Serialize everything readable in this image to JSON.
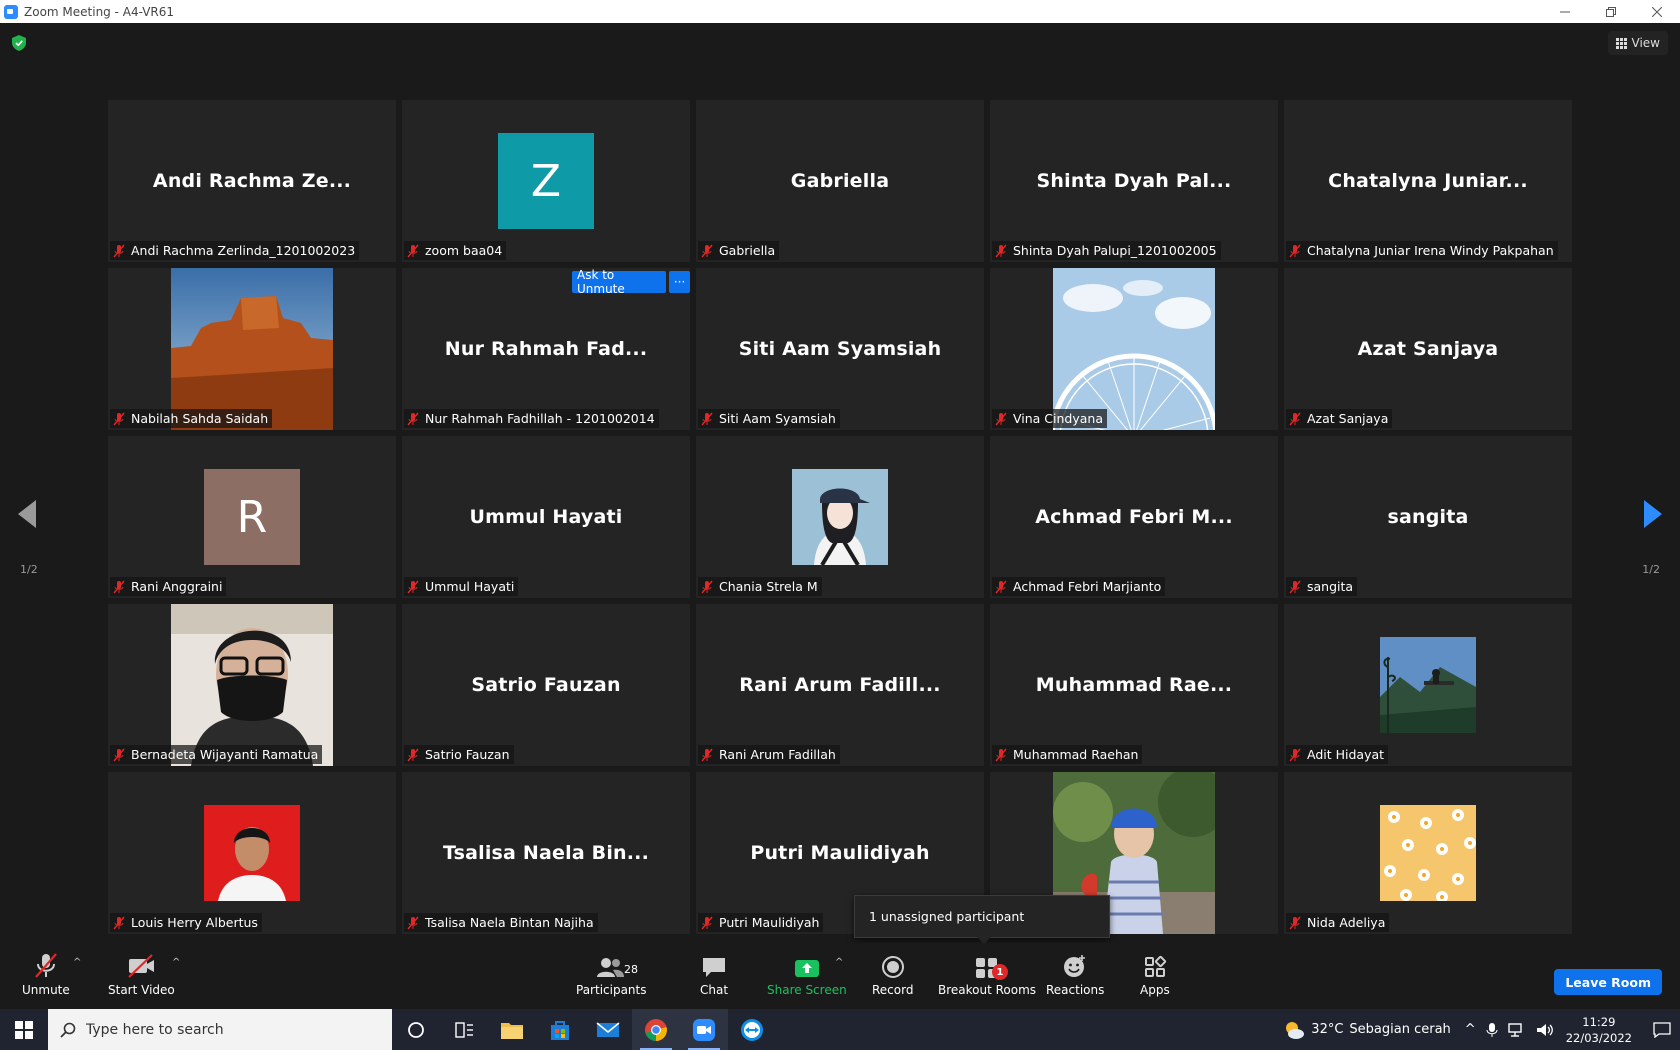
{
  "window": {
    "title": "Zoom Meeting - A4-VR61"
  },
  "header": {
    "view_label": "View"
  },
  "pagination": {
    "left": "1/2",
    "right": "1/2"
  },
  "tiles": [
    {
      "display_name": "Andi Rachma Ze...",
      "label": "Andi Rachma Zerlinda_1201002023",
      "kind": "name"
    },
    {
      "display_name": "Z",
      "label": "zoom baa04",
      "kind": "letter",
      "color": "#0e9aa7"
    },
    {
      "display_name": "Gabriella",
      "label": "Gabriella",
      "kind": "name"
    },
    {
      "display_name": "Shinta Dyah Pal...",
      "label": "Shinta Dyah Palupi_1201002005",
      "kind": "name"
    },
    {
      "display_name": "Chatalyna Juniar...",
      "label": "Chatalyna Juniar Irena Windy Pakpahan",
      "kind": "name"
    },
    {
      "display_name": "",
      "label": "Nabilah Sahda Saidah",
      "kind": "photo",
      "photo": "desert-butte"
    },
    {
      "display_name": "Nur Rahmah Fad...",
      "label": "Nur Rahmah Fadhillah - 1201002014",
      "kind": "name",
      "ask_unmute": "Ask to Unmute",
      "more": "···"
    },
    {
      "display_name": "Siti Aam Syamsiah",
      "label": "Siti Aam Syamsiah",
      "kind": "name"
    },
    {
      "display_name": "",
      "label": "Vina Cindyana",
      "kind": "photo",
      "photo": "ferris-wheel"
    },
    {
      "display_name": "Azat Sanjaya",
      "label": "Azat Sanjaya",
      "kind": "name"
    },
    {
      "display_name": "R",
      "label": "Rani Anggraini",
      "kind": "letter",
      "color": "#8c6e64"
    },
    {
      "display_name": "Ummul Hayati",
      "label": "Ummul Hayati",
      "kind": "name"
    },
    {
      "display_name": "",
      "label": "Chania Strela M",
      "kind": "photo-sq",
      "photo": "illustration-girl"
    },
    {
      "display_name": "Achmad Febri M...",
      "label": "Achmad Febri Marjianto",
      "kind": "name"
    },
    {
      "display_name": "sangita",
      "label": "sangita",
      "kind": "name"
    },
    {
      "display_name": "",
      "label": "Bernadeta Wijayanti Ramatua",
      "kind": "photo",
      "photo": "masked-person"
    },
    {
      "display_name": "Satrio Fauzan",
      "label": "Satrio Fauzan",
      "kind": "name"
    },
    {
      "display_name": "Rani Arum Fadill...",
      "label": "Rani Arum Fadillah",
      "kind": "name"
    },
    {
      "display_name": "Muhammad Rae...",
      "label": "Muhammad Raehan",
      "kind": "name"
    },
    {
      "display_name": "",
      "label": "Adit Hidayat",
      "kind": "photo-sq",
      "photo": "forest-swing"
    },
    {
      "display_name": "",
      "label": "Louis Herry Albertus",
      "kind": "photo-sq",
      "photo": "red-portrait"
    },
    {
      "display_name": "Tsalisa Naela Bin...",
      "label": "Tsalisa Naela Bintan Najiha",
      "kind": "name"
    },
    {
      "display_name": "Putri Maulidiyah",
      "label": "Putri Maulidiyah",
      "kind": "name"
    },
    {
      "display_name": "",
      "label": "",
      "kind": "photo",
      "photo": "child-helmet"
    },
    {
      "display_name": "",
      "label": "Nida Adeliya",
      "kind": "photo-sq",
      "photo": "daisy-pattern"
    }
  ],
  "tooltip": {
    "text": "1 unassigned participant"
  },
  "toolbar": {
    "unmute": "Unmute",
    "start_video": "Start Video",
    "participants": "Participants",
    "participants_count": "28",
    "chat": "Chat",
    "share_screen": "Share Screen",
    "record": "Record",
    "breakout_rooms": "Breakout Rooms",
    "breakout_badge": "1",
    "reactions": "Reactions",
    "apps": "Apps",
    "leave": "Leave Room"
  },
  "taskbar": {
    "search_placeholder": "Type here to search",
    "temperature": "32°C",
    "weather": "Sebagian cerah",
    "time": "11:29",
    "date": "22/03/2022"
  },
  "colors": {
    "accent": "#0e72ed",
    "share": "#19c25e",
    "muted": "#e02828"
  }
}
